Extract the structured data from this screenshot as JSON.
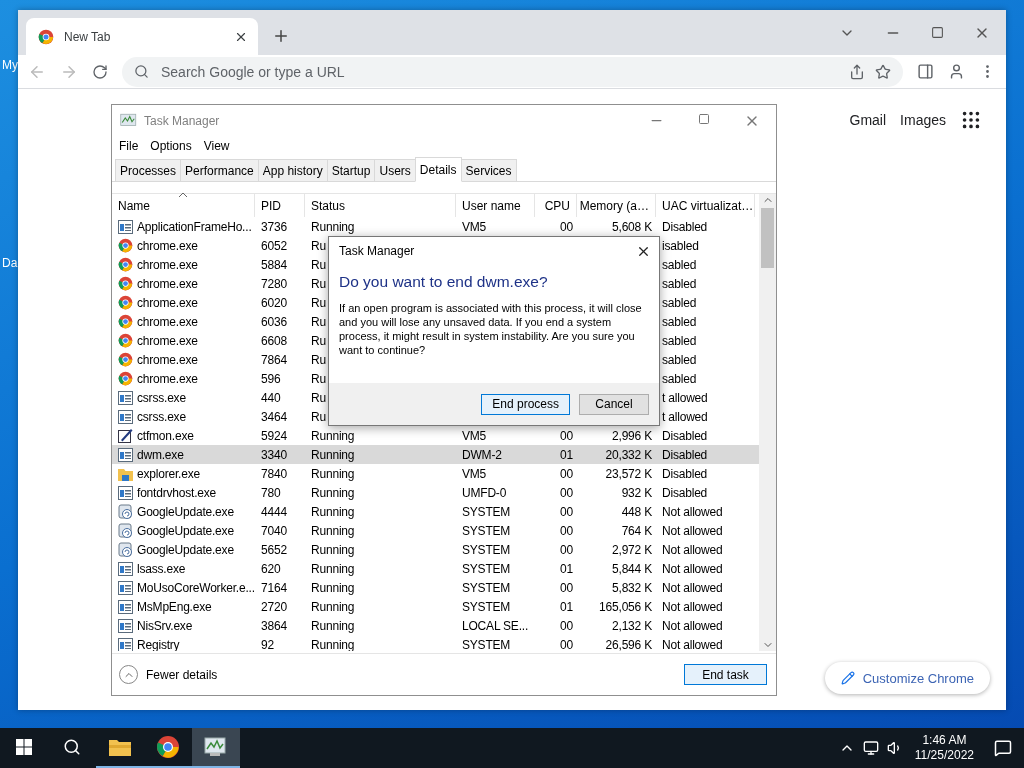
{
  "desktop": {
    "labels": [
      "My",
      "Da"
    ]
  },
  "browser": {
    "tab": {
      "title": "New Tab"
    },
    "omnibox": {
      "placeholder": "Search Google or type a URL"
    },
    "links": [
      "Gmail",
      "Images"
    ],
    "customize_button": "Customize Chrome"
  },
  "task_manager": {
    "title": "Task Manager",
    "menu": [
      "File",
      "Options",
      "View"
    ],
    "tabs": [
      {
        "label": "Processes",
        "selected": false
      },
      {
        "label": "Performance",
        "selected": false
      },
      {
        "label": "App history",
        "selected": false
      },
      {
        "label": "Startup",
        "selected": false
      },
      {
        "label": "Users",
        "selected": false
      },
      {
        "label": "Details",
        "selected": true
      },
      {
        "label": "Services",
        "selected": false
      }
    ],
    "columns": [
      "Name",
      "PID",
      "Status",
      "User name",
      "CPU",
      "Memory (a…",
      "UAC virtualizat…"
    ],
    "rows": [
      {
        "kind": "app",
        "name": "ApplicationFrameHo...",
        "pid": "3736",
        "status": "Running",
        "user": "VM5",
        "cpu": "00",
        "memory": "5,608 K",
        "uac": "Disabled",
        "selected": false
      },
      {
        "kind": "chrome",
        "name": "chrome.exe",
        "pid": "6052",
        "status": "Ru",
        "uac": "isabled",
        "selected": false
      },
      {
        "kind": "chrome",
        "name": "chrome.exe",
        "pid": "5884",
        "status": "Ru",
        "uac": "sabled",
        "selected": false
      },
      {
        "kind": "chrome",
        "name": "chrome.exe",
        "pid": "7280",
        "status": "Ru",
        "uac": "sabled",
        "selected": false
      },
      {
        "kind": "chrome",
        "name": "chrome.exe",
        "pid": "6020",
        "status": "Ru",
        "uac": "sabled",
        "selected": false
      },
      {
        "kind": "chrome",
        "name": "chrome.exe",
        "pid": "6036",
        "status": "Ru",
        "uac": "sabled",
        "selected": false
      },
      {
        "kind": "chrome",
        "name": "chrome.exe",
        "pid": "6608",
        "status": "Ru",
        "uac": "sabled",
        "selected": false
      },
      {
        "kind": "chrome",
        "name": "chrome.exe",
        "pid": "7864",
        "status": "Ru",
        "uac": "sabled",
        "selected": false
      },
      {
        "kind": "chrome",
        "name": "chrome.exe",
        "pid": "596",
        "status": "Ru",
        "uac": "sabled",
        "selected": false
      },
      {
        "kind": "app",
        "name": "csrss.exe",
        "pid": "440",
        "status": "Ru",
        "uac": "t allowed",
        "selected": false
      },
      {
        "kind": "app",
        "name": "csrss.exe",
        "pid": "3464",
        "status": "Ru",
        "uac": "t allowed",
        "selected": false
      },
      {
        "kind": "pen",
        "name": "ctfmon.exe",
        "pid": "5924",
        "status": "Running",
        "user": "VM5",
        "cpu": "00",
        "memory": "2,996 K",
        "uac": "Disabled",
        "selected": false
      },
      {
        "kind": "app",
        "name": "dwm.exe",
        "pid": "3340",
        "status": "Running",
        "user": "DWM-2",
        "cpu": "01",
        "memory": "20,332 K",
        "uac": "Disabled",
        "selected": true
      },
      {
        "kind": "folder",
        "name": "explorer.exe",
        "pid": "7840",
        "status": "Running",
        "user": "VM5",
        "cpu": "00",
        "memory": "23,572 K",
        "uac": "Disabled",
        "selected": false
      },
      {
        "kind": "app",
        "name": "fontdrvhost.exe",
        "pid": "780",
        "status": "Running",
        "user": "UMFD-0",
        "cpu": "00",
        "memory": "932 K",
        "uac": "Disabled",
        "selected": false
      },
      {
        "kind": "update",
        "name": "GoogleUpdate.exe",
        "pid": "4444",
        "status": "Running",
        "user": "SYSTEM",
        "cpu": "00",
        "memory": "448 K",
        "uac": "Not allowed",
        "selected": false
      },
      {
        "kind": "update",
        "name": "GoogleUpdate.exe",
        "pid": "7040",
        "status": "Running",
        "user": "SYSTEM",
        "cpu": "00",
        "memory": "764 K",
        "uac": "Not allowed",
        "selected": false
      },
      {
        "kind": "update",
        "name": "GoogleUpdate.exe",
        "pid": "5652",
        "status": "Running",
        "user": "SYSTEM",
        "cpu": "00",
        "memory": "2,972 K",
        "uac": "Not allowed",
        "selected": false
      },
      {
        "kind": "app",
        "name": "lsass.exe",
        "pid": "620",
        "status": "Running",
        "user": "SYSTEM",
        "cpu": "01",
        "memory": "5,844 K",
        "uac": "Not allowed",
        "selected": false
      },
      {
        "kind": "app",
        "name": "MoUsoCoreWorker.e...",
        "pid": "7164",
        "status": "Running",
        "user": "SYSTEM",
        "cpu": "00",
        "memory": "5,832 K",
        "uac": "Not allowed",
        "selected": false
      },
      {
        "kind": "app",
        "name": "MsMpEng.exe",
        "pid": "2720",
        "status": "Running",
        "user": "SYSTEM",
        "cpu": "01",
        "memory": "165,056 K",
        "uac": "Not allowed",
        "selected": false
      },
      {
        "kind": "app",
        "name": "NisSrv.exe",
        "pid": "3864",
        "status": "Running",
        "user": "LOCAL SE...",
        "cpu": "00",
        "memory": "2,132 K",
        "uac": "Not allowed",
        "selected": false
      },
      {
        "kind": "app",
        "name": "Registry",
        "pid": "92",
        "status": "Running",
        "user": "SYSTEM",
        "cpu": "00",
        "memory": "26,596 K",
        "uac": "Not allowed",
        "selected": false
      }
    ],
    "fewer_details": "Fewer details",
    "end_task": "End task"
  },
  "dialog": {
    "title": "Task Manager",
    "heading": "Do you want to end dwm.exe?",
    "message": "If an open program is associated with this process, it will close and you will lose any unsaved data. If you end a system process, it might result in system instability. Are you sure you want to continue?",
    "buttons": [
      {
        "label": "End process",
        "kind": "primary"
      },
      {
        "label": "Cancel",
        "kind": "secondary"
      }
    ]
  },
  "taskbar": {
    "apps": [
      {
        "kind": "explorer",
        "selected": false
      },
      {
        "kind": "chrome",
        "selected": false
      },
      {
        "kind": "taskmgr",
        "selected": true
      }
    ],
    "time": "1:46 AM",
    "date": "11/25/2022"
  }
}
